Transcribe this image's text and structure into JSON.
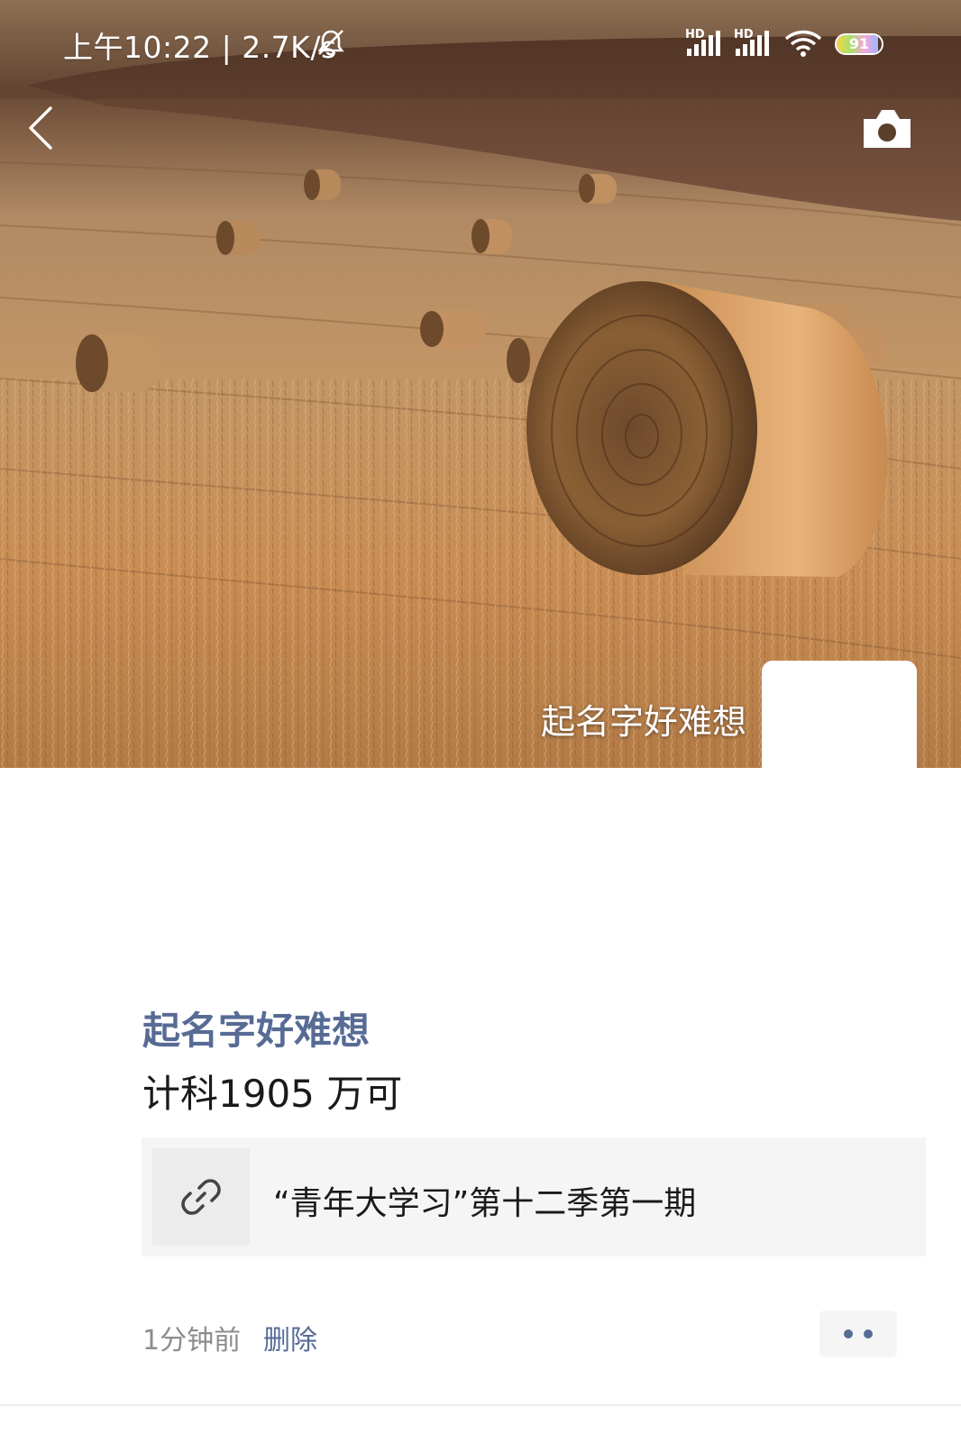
{
  "status_bar": {
    "time_speed": "上午10:22 | 2.7K/s",
    "bell_icon": "bell-muted-icon",
    "signal_label": "HD",
    "battery_level": "91",
    "battery_fraction": 0.91
  },
  "nav": {
    "back_icon": "chevron-left-icon",
    "camera_icon": "camera-icon"
  },
  "cover": {
    "name": "起名字好难想",
    "photo": "hay-bales-field"
  },
  "post": {
    "author": "起名字好难想",
    "text": "计科1905 万可",
    "link": {
      "icon": "link-icon",
      "title": "“青年大学习”第十二季第一期"
    },
    "time": "1分钟前",
    "delete_label": "删除",
    "more_icon": "more-dots-icon"
  },
  "colors": {
    "name_blue": "#576b95",
    "text_dark": "#1a1a1a",
    "text_gray": "#8c8c8c",
    "card_bg": "#f5f5f5"
  }
}
